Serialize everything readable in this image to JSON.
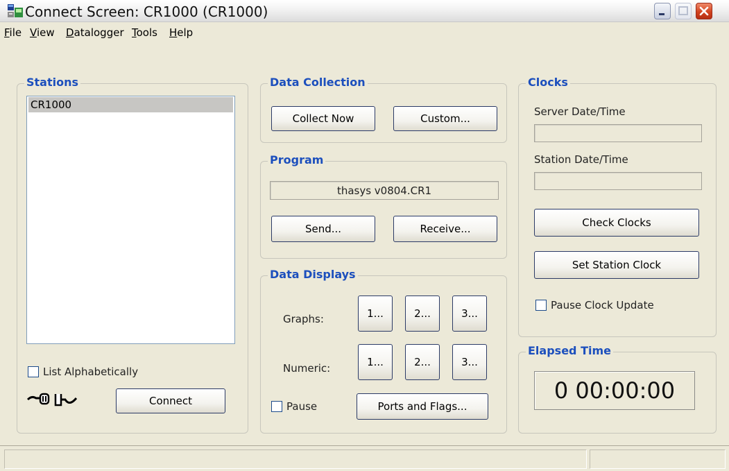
{
  "window": {
    "title": "Connect Screen: CR1000 (CR1000)"
  },
  "menu": {
    "items": [
      {
        "label": "File",
        "mnemonic": "F"
      },
      {
        "label": "View",
        "mnemonic": "V"
      },
      {
        "label": "Datalogger",
        "mnemonic": "D"
      },
      {
        "label": "Tools",
        "mnemonic": "T"
      },
      {
        "label": "Help",
        "mnemonic": "H"
      }
    ]
  },
  "stations": {
    "title": "Stations",
    "items": [
      "CR1000"
    ],
    "selected": "CR1000",
    "list_alphabetically_label": "List Alphabetically",
    "list_alphabetically_checked": false,
    "connect_button": "Connect",
    "connection_icon": "disconnected-plug-icon"
  },
  "data_collection": {
    "title": "Data Collection",
    "collect_now_button": "Collect Now",
    "custom_button": "Custom..."
  },
  "program": {
    "title": "Program",
    "file_name": "thasys v0804.CR1",
    "send_button": "Send...",
    "receive_button": "Receive..."
  },
  "data_displays": {
    "title": "Data Displays",
    "graphs_label": "Graphs:",
    "numeric_label": "Numeric:",
    "graph_buttons": [
      "1...",
      "2...",
      "3..."
    ],
    "numeric_buttons": [
      "1...",
      "2...",
      "3..."
    ],
    "pause_label": "Pause",
    "pause_checked": false,
    "ports_flags_button": "Ports and Flags..."
  },
  "clocks": {
    "title": "Clocks",
    "server_label": "Server Date/Time",
    "server_value": "",
    "station_label": "Station Date/Time",
    "station_value": "",
    "check_clocks_button": "Check Clocks",
    "set_station_clock_button": "Set Station Clock",
    "pause_clock_update_label": "Pause Clock Update",
    "pause_clock_update_checked": false
  },
  "elapsed_time": {
    "title": "Elapsed Time",
    "value": "0 00:00:00"
  },
  "colors": {
    "group_title": "#1c4fbd",
    "window_bg": "#ece9d8",
    "close_button": "#d2431f"
  }
}
